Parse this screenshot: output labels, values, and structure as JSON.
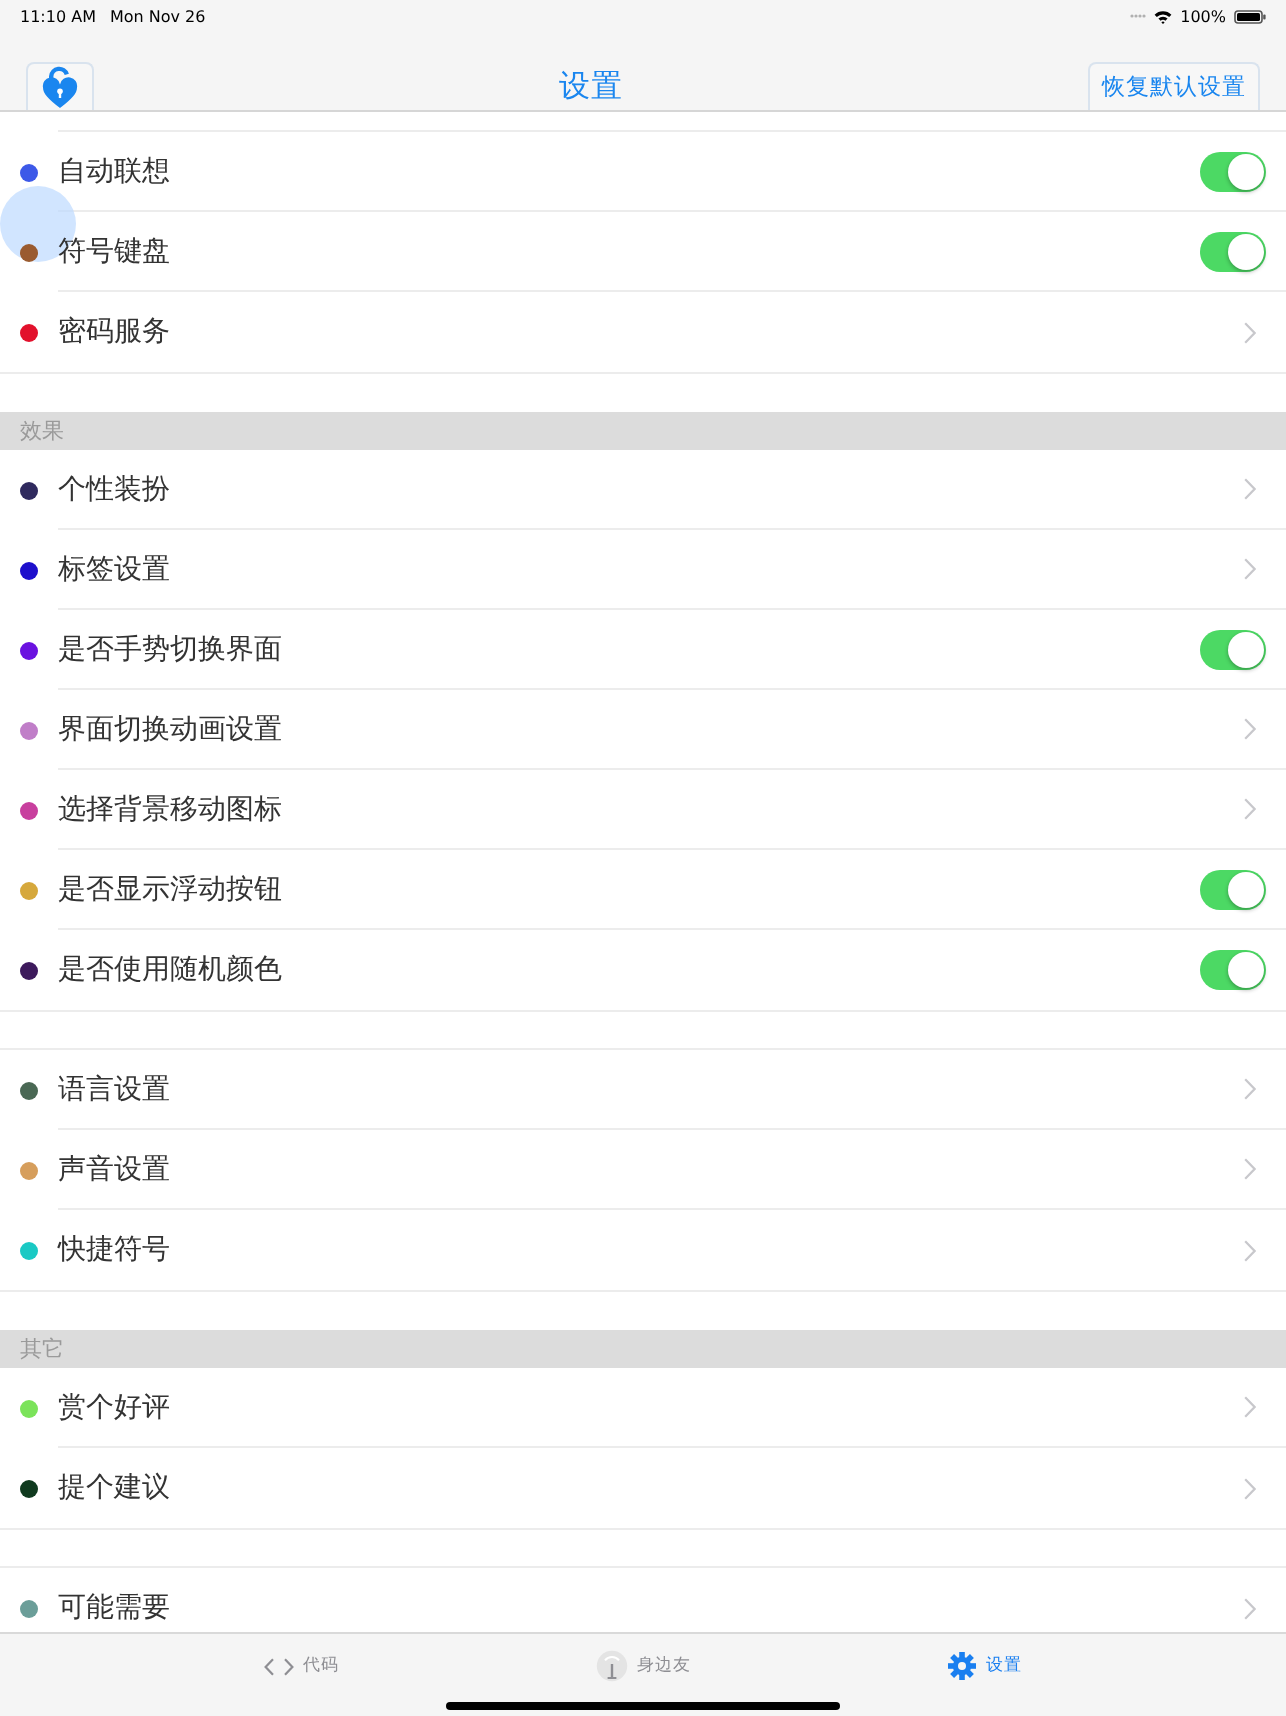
{
  "status_bar": {
    "time": "11:10 AM",
    "date": "Mon Nov 26",
    "battery": "100%"
  },
  "nav_bar": {
    "title": "设置",
    "reset_button": "恢复默认设置"
  },
  "sections": [
    {
      "rows": [
        {
          "label": "自动联想",
          "color": "#3d59e8",
          "kind": "toggle",
          "on": true
        },
        {
          "label": "符号键盘",
          "color": "#9a5b30",
          "kind": "toggle",
          "on": true
        },
        {
          "label": "密码服务",
          "color": "#e2112c",
          "kind": "link"
        }
      ]
    },
    {
      "header": "效果",
      "rows": [
        {
          "label": "个性装扮",
          "color": "#2f2a5e",
          "kind": "link"
        },
        {
          "label": "标签设置",
          "color": "#1d0fcc",
          "kind": "link"
        },
        {
          "label": "是否手势切换界面",
          "color": "#6a12e0",
          "kind": "toggle",
          "on": true
        },
        {
          "label": "界面切换动画设置",
          "color": "#c07ec8",
          "kind": "link"
        },
        {
          "label": "选择背景移动图标",
          "color": "#c83f9e",
          "kind": "link"
        },
        {
          "label": "是否显示浮动按钮",
          "color": "#d6a83c",
          "kind": "toggle",
          "on": true
        },
        {
          "label": "是否使用随机颜色",
          "color": "#3d1a5c",
          "kind": "toggle",
          "on": true
        }
      ]
    },
    {
      "rows": [
        {
          "label": "语言设置",
          "color": "#4a6854",
          "kind": "link"
        },
        {
          "label": "声音设置",
          "color": "#d69e5c",
          "kind": "link"
        },
        {
          "label": "快捷符号",
          "color": "#1ac9c4",
          "kind": "link"
        }
      ]
    },
    {
      "header": "其它",
      "rows": [
        {
          "label": "赏个好评",
          "color": "#7be35a",
          "kind": "link"
        },
        {
          "label": "提个建议",
          "color": "#103a1f",
          "kind": "link"
        }
      ]
    },
    {
      "rows": [
        {
          "label": "可能需要",
          "color": "#6b9e99",
          "kind": "link"
        }
      ]
    }
  ],
  "tab_bar": [
    {
      "label": "代码",
      "kind": "code",
      "selected": false
    },
    {
      "label": "身边友",
      "kind": "antenna",
      "selected": false
    },
    {
      "label": "设置",
      "kind": "gear",
      "selected": true
    }
  ]
}
